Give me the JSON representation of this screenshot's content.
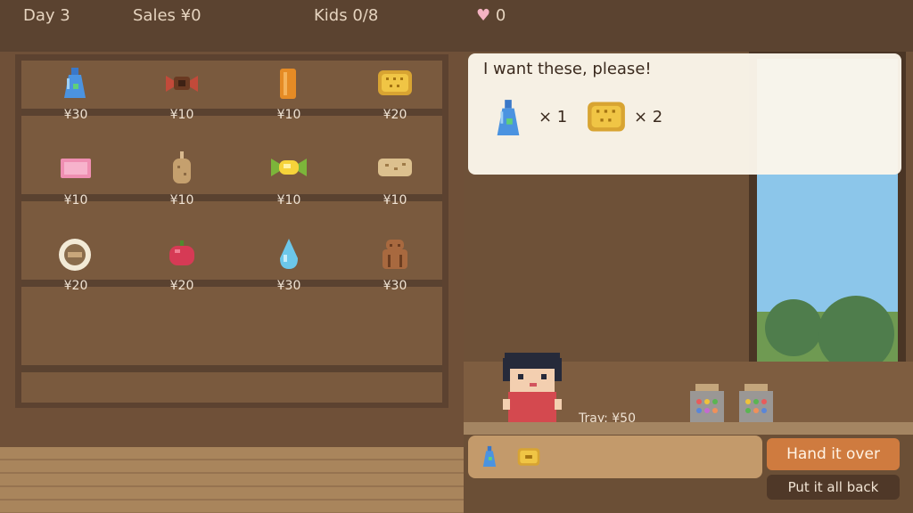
{
  "hud": {
    "day": "Day 3",
    "sales": "Sales ¥0",
    "kids": "Kids 0/8",
    "hearts": "0"
  },
  "shelf": {
    "items": [
      {
        "name": "blue-bottle",
        "price": "¥30"
      },
      {
        "name": "chocolate-candy",
        "price": "¥10"
      },
      {
        "name": "orange-stick",
        "price": "¥10"
      },
      {
        "name": "gold-biscuit",
        "price": "¥20"
      },
      {
        "name": "pink-gum",
        "price": "¥10"
      },
      {
        "name": "potato-stick",
        "price": "¥10"
      },
      {
        "name": "wrapped-candy",
        "price": "¥10"
      },
      {
        "name": "cracker",
        "price": "¥10"
      },
      {
        "name": "round-rice-cracker",
        "price": "¥20"
      },
      {
        "name": "red-apple",
        "price": "¥20"
      },
      {
        "name": "water-drop-candy",
        "price": "¥30"
      },
      {
        "name": "brown-doll",
        "price": "¥30"
      }
    ]
  },
  "request": {
    "text": "I want these, please!",
    "items": [
      {
        "icon": "blue-bottle-icon",
        "qty": "× 1"
      },
      {
        "icon": "gold-biscuit-icon",
        "qty": "× 2"
      }
    ]
  },
  "tray": {
    "label": "Tray: ¥50",
    "items": [
      "blue-bottle-icon",
      "gold-biscuit-icon"
    ]
  },
  "buttons": {
    "hand_over": "Hand it over",
    "put_back": "Put it all back"
  }
}
